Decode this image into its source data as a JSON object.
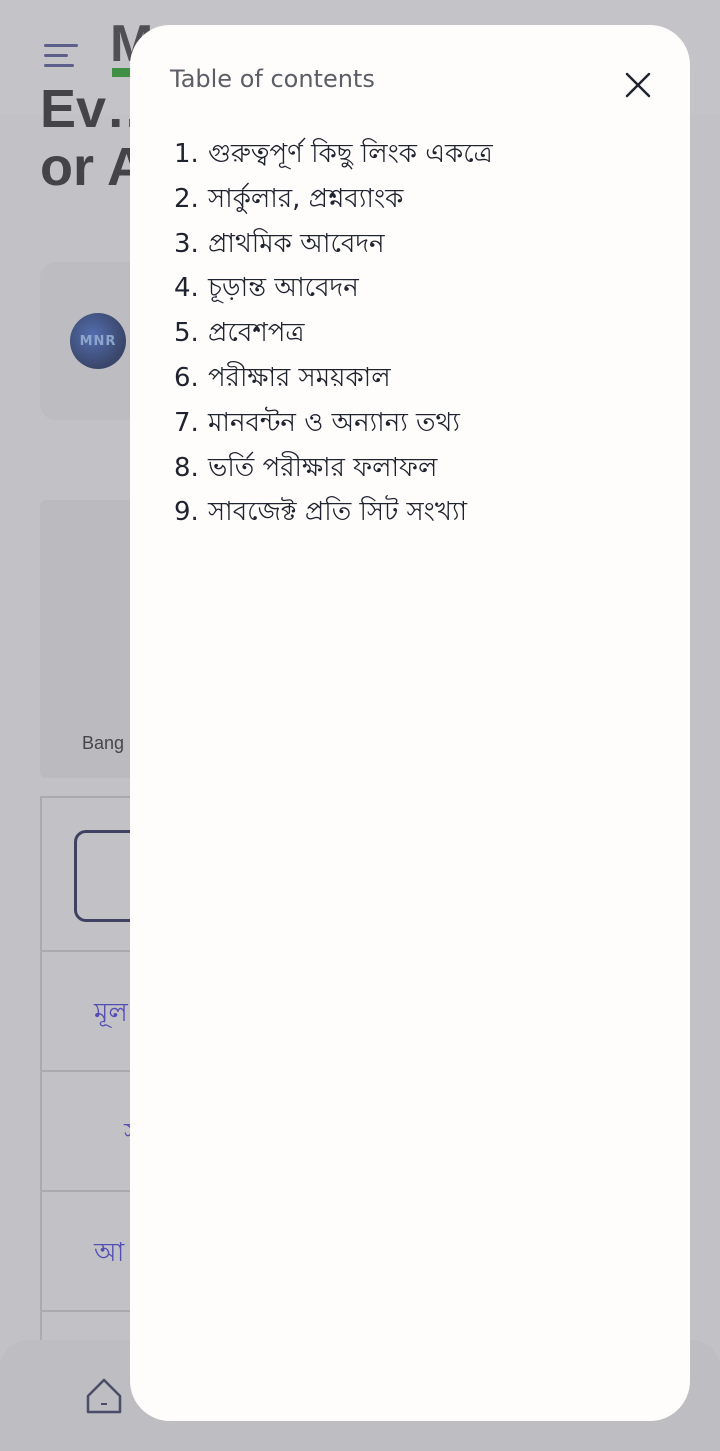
{
  "background": {
    "logo_text": "M",
    "title": "Ev…\nor A",
    "image_caption": "Bang",
    "links": [
      "মূল",
      "স",
      "আ"
    ],
    "avatar_text": "MNR"
  },
  "toc": {
    "title": "Table of contents",
    "items": [
      {
        "num": "1.",
        "label": "গুরুত্বপূর্ণ কিছু লিংক একত্রে"
      },
      {
        "num": "2.",
        "label": "সার্কুলার, প্রশ্নব্যাংক"
      },
      {
        "num": "3.",
        "label": "প্রাথমিক আবেদন"
      },
      {
        "num": "4.",
        "label": "চূড়ান্ত আবেদন"
      },
      {
        "num": "5.",
        "label": "প্রবেশপত্র"
      },
      {
        "num": "6.",
        "label": "পরীক্ষার সময়কাল"
      },
      {
        "num": "7.",
        "label": "মানবন্টন ও অন্যান্য তথ্য"
      },
      {
        "num": "8.",
        "label": "ভর্তি পরীক্ষার ফলাফল"
      },
      {
        "num": "9.",
        "label": "সাবজেক্ট প্রতি সিট সংখ্যা"
      }
    ]
  },
  "icons": {
    "menu": "menu-icon",
    "close": "close-icon",
    "home": "home-icon"
  }
}
